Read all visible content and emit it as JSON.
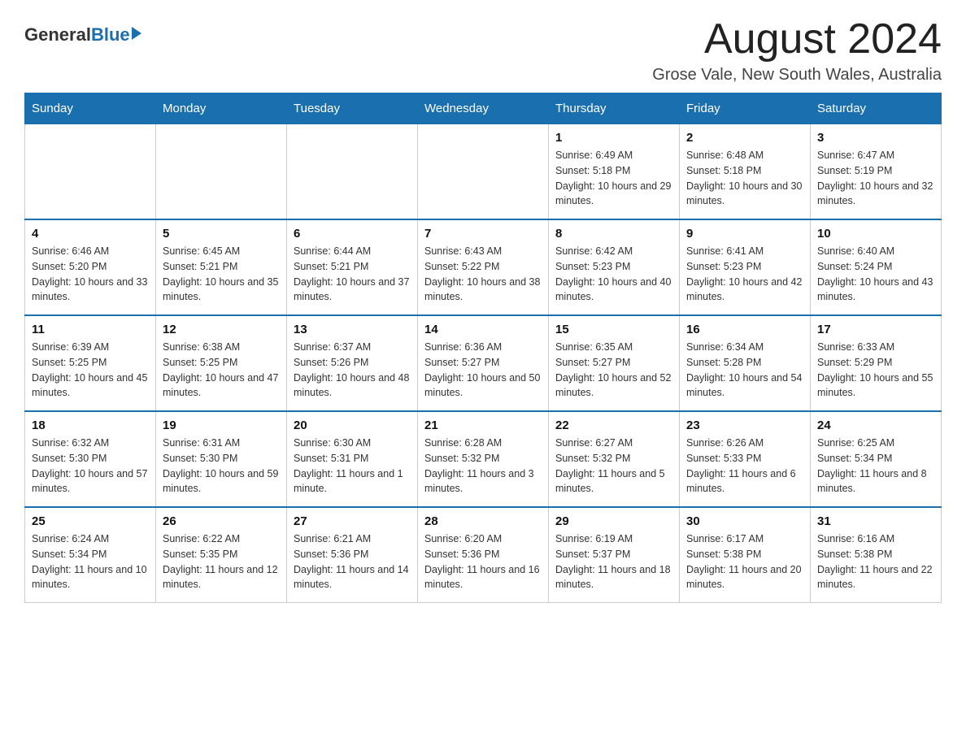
{
  "header": {
    "logo_text_general": "General",
    "logo_text_blue": "Blue",
    "month_title": "August 2024",
    "location": "Grose Vale, New South Wales, Australia"
  },
  "calendar": {
    "days_of_week": [
      "Sunday",
      "Monday",
      "Tuesday",
      "Wednesday",
      "Thursday",
      "Friday",
      "Saturday"
    ],
    "weeks": [
      [
        {
          "day": "",
          "info": ""
        },
        {
          "day": "",
          "info": ""
        },
        {
          "day": "",
          "info": ""
        },
        {
          "day": "",
          "info": ""
        },
        {
          "day": "1",
          "info": "Sunrise: 6:49 AM\nSunset: 5:18 PM\nDaylight: 10 hours and 29 minutes."
        },
        {
          "day": "2",
          "info": "Sunrise: 6:48 AM\nSunset: 5:18 PM\nDaylight: 10 hours and 30 minutes."
        },
        {
          "day": "3",
          "info": "Sunrise: 6:47 AM\nSunset: 5:19 PM\nDaylight: 10 hours and 32 minutes."
        }
      ],
      [
        {
          "day": "4",
          "info": "Sunrise: 6:46 AM\nSunset: 5:20 PM\nDaylight: 10 hours and 33 minutes."
        },
        {
          "day": "5",
          "info": "Sunrise: 6:45 AM\nSunset: 5:21 PM\nDaylight: 10 hours and 35 minutes."
        },
        {
          "day": "6",
          "info": "Sunrise: 6:44 AM\nSunset: 5:21 PM\nDaylight: 10 hours and 37 minutes."
        },
        {
          "day": "7",
          "info": "Sunrise: 6:43 AM\nSunset: 5:22 PM\nDaylight: 10 hours and 38 minutes."
        },
        {
          "day": "8",
          "info": "Sunrise: 6:42 AM\nSunset: 5:23 PM\nDaylight: 10 hours and 40 minutes."
        },
        {
          "day": "9",
          "info": "Sunrise: 6:41 AM\nSunset: 5:23 PM\nDaylight: 10 hours and 42 minutes."
        },
        {
          "day": "10",
          "info": "Sunrise: 6:40 AM\nSunset: 5:24 PM\nDaylight: 10 hours and 43 minutes."
        }
      ],
      [
        {
          "day": "11",
          "info": "Sunrise: 6:39 AM\nSunset: 5:25 PM\nDaylight: 10 hours and 45 minutes."
        },
        {
          "day": "12",
          "info": "Sunrise: 6:38 AM\nSunset: 5:25 PM\nDaylight: 10 hours and 47 minutes."
        },
        {
          "day": "13",
          "info": "Sunrise: 6:37 AM\nSunset: 5:26 PM\nDaylight: 10 hours and 48 minutes."
        },
        {
          "day": "14",
          "info": "Sunrise: 6:36 AM\nSunset: 5:27 PM\nDaylight: 10 hours and 50 minutes."
        },
        {
          "day": "15",
          "info": "Sunrise: 6:35 AM\nSunset: 5:27 PM\nDaylight: 10 hours and 52 minutes."
        },
        {
          "day": "16",
          "info": "Sunrise: 6:34 AM\nSunset: 5:28 PM\nDaylight: 10 hours and 54 minutes."
        },
        {
          "day": "17",
          "info": "Sunrise: 6:33 AM\nSunset: 5:29 PM\nDaylight: 10 hours and 55 minutes."
        }
      ],
      [
        {
          "day": "18",
          "info": "Sunrise: 6:32 AM\nSunset: 5:30 PM\nDaylight: 10 hours and 57 minutes."
        },
        {
          "day": "19",
          "info": "Sunrise: 6:31 AM\nSunset: 5:30 PM\nDaylight: 10 hours and 59 minutes."
        },
        {
          "day": "20",
          "info": "Sunrise: 6:30 AM\nSunset: 5:31 PM\nDaylight: 11 hours and 1 minute."
        },
        {
          "day": "21",
          "info": "Sunrise: 6:28 AM\nSunset: 5:32 PM\nDaylight: 11 hours and 3 minutes."
        },
        {
          "day": "22",
          "info": "Sunrise: 6:27 AM\nSunset: 5:32 PM\nDaylight: 11 hours and 5 minutes."
        },
        {
          "day": "23",
          "info": "Sunrise: 6:26 AM\nSunset: 5:33 PM\nDaylight: 11 hours and 6 minutes."
        },
        {
          "day": "24",
          "info": "Sunrise: 6:25 AM\nSunset: 5:34 PM\nDaylight: 11 hours and 8 minutes."
        }
      ],
      [
        {
          "day": "25",
          "info": "Sunrise: 6:24 AM\nSunset: 5:34 PM\nDaylight: 11 hours and 10 minutes."
        },
        {
          "day": "26",
          "info": "Sunrise: 6:22 AM\nSunset: 5:35 PM\nDaylight: 11 hours and 12 minutes."
        },
        {
          "day": "27",
          "info": "Sunrise: 6:21 AM\nSunset: 5:36 PM\nDaylight: 11 hours and 14 minutes."
        },
        {
          "day": "28",
          "info": "Sunrise: 6:20 AM\nSunset: 5:36 PM\nDaylight: 11 hours and 16 minutes."
        },
        {
          "day": "29",
          "info": "Sunrise: 6:19 AM\nSunset: 5:37 PM\nDaylight: 11 hours and 18 minutes."
        },
        {
          "day": "30",
          "info": "Sunrise: 6:17 AM\nSunset: 5:38 PM\nDaylight: 11 hours and 20 minutes."
        },
        {
          "day": "31",
          "info": "Sunrise: 6:16 AM\nSunset: 5:38 PM\nDaylight: 11 hours and 22 minutes."
        }
      ]
    ]
  }
}
